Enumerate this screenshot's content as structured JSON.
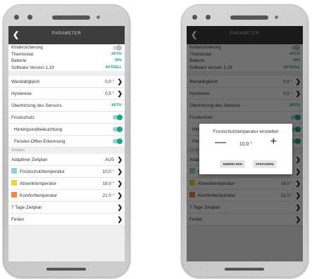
{
  "colors": {
    "accent": "#1aa58c",
    "header": "#3d3d3d",
    "frost": "#8fd3d6",
    "absenk": "#f2d33a",
    "komfort": "#f08a3a"
  },
  "header": {
    "back_icon": "chevron-left-icon",
    "back_glyph": "❮",
    "title": "PARAMETER"
  },
  "info": [
    {
      "label": "Kindersicherung",
      "value": ""
    },
    {
      "label": "Thermostat",
      "value": "AKTIV"
    },
    {
      "label": "Batterie",
      "value": "90%"
    },
    {
      "label": "Software Version 1,19",
      "value": "AKTUELL"
    }
  ],
  "settings": {
    "chevron": "❯",
    "wandabgleich": {
      "label": "Wandabgleich",
      "value": "0,0 °"
    },
    "hysterese": {
      "label": "Hysterese",
      "value": "0,5 °"
    },
    "ueberhitzung": {
      "label": "Überhitzung des Sensors",
      "value": "AKTIV"
    },
    "frostschutz": {
      "label": "Frostschutz"
    },
    "hintergrund": {
      "label": "Hintergrundbeleuchtung"
    },
    "fenster": {
      "label": "Fenster-Offen-Erkennung"
    }
  },
  "zeitplan": {
    "section": "Zeitplan",
    "adaptiv": {
      "label": "Adaptiver Zeitplan",
      "value": "AUS"
    },
    "frost": {
      "label": "Frostschutztemperatur",
      "value": "10,0 °"
    },
    "absenk": {
      "label": "Absenktemperatur",
      "value": "16,0 °"
    },
    "komfort": {
      "label": "Komforttemperatur",
      "value": "21,0 °"
    },
    "sieben": {
      "label": "7 Tage Zeitplan"
    },
    "ferien": {
      "label": "Ferien"
    }
  },
  "modal": {
    "title": "Frostschutztemperatur einstellen",
    "minus": "—",
    "value": "10,0 °",
    "plus": "+",
    "cancel": "ABBRECHEN",
    "save": "SPEICHERN"
  }
}
